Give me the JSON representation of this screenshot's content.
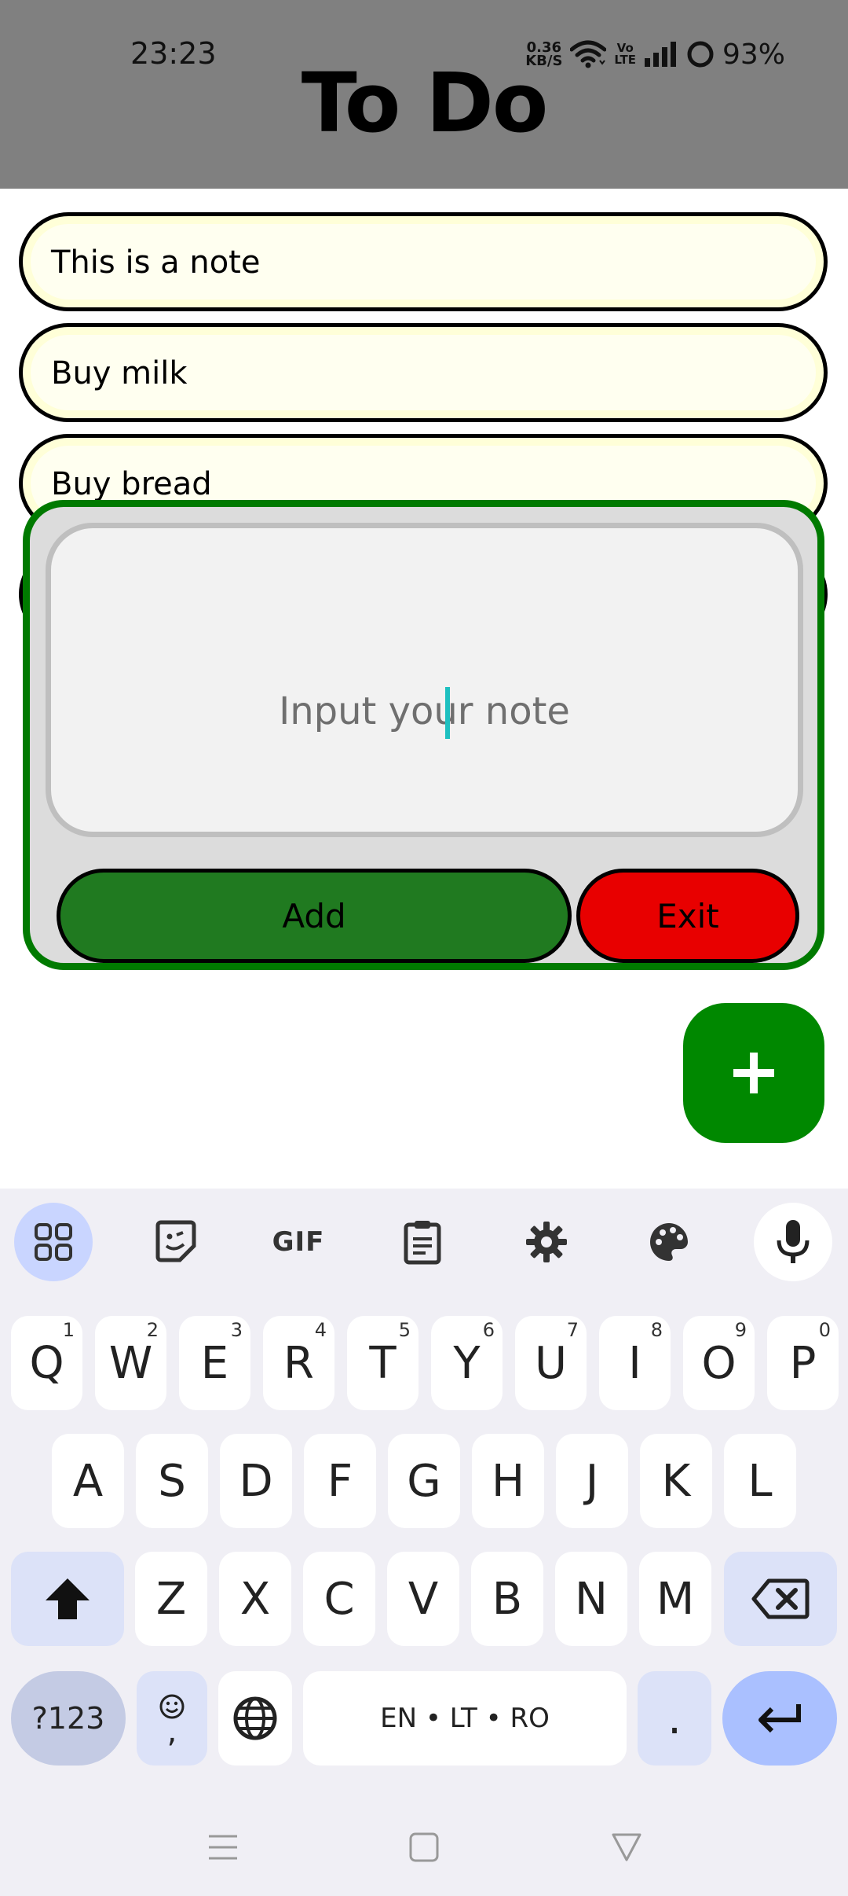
{
  "status_bar": {
    "time": "23:23",
    "net_speed_value": "0.36",
    "net_speed_unit": "KB/S",
    "volte_top": "Vo",
    "volte_bottom": "LTE",
    "battery": "93%"
  },
  "app": {
    "title": "To Do"
  },
  "notes": [
    {
      "text": "This is a note"
    },
    {
      "text": "Buy milk"
    },
    {
      "text": "Buy bread"
    }
  ],
  "dialog": {
    "input_placeholder": "Input your note",
    "add_label": "Add",
    "exit_label": "Exit"
  },
  "fab": {
    "label": "+"
  },
  "keyboard": {
    "toolbar": {
      "gif_label": "GIF"
    },
    "row1": [
      {
        "key": "Q",
        "hint": "1"
      },
      {
        "key": "W",
        "hint": "2"
      },
      {
        "key": "E",
        "hint": "3"
      },
      {
        "key": "R",
        "hint": "4"
      },
      {
        "key": "T",
        "hint": "5"
      },
      {
        "key": "Y",
        "hint": "6"
      },
      {
        "key": "U",
        "hint": "7"
      },
      {
        "key": "I",
        "hint": "8"
      },
      {
        "key": "O",
        "hint": "9"
      },
      {
        "key": "P",
        "hint": "0"
      }
    ],
    "row2": [
      "A",
      "S",
      "D",
      "F",
      "G",
      "H",
      "J",
      "K",
      "L"
    ],
    "row3": [
      "Z",
      "X",
      "C",
      "V",
      "B",
      "N",
      "M"
    ],
    "symbols_label": "?123",
    "emoji_comma": ",",
    "space_label": "EN • LT • RO",
    "period_label": "."
  },
  "colors": {
    "header_bg": "#808080",
    "note_bg": "#fffff0",
    "dialog_border": "#007a00",
    "add_button": "#207a20",
    "exit_button": "#e80000",
    "fab_bg": "#008800",
    "caret": "#1ec0c0"
  }
}
